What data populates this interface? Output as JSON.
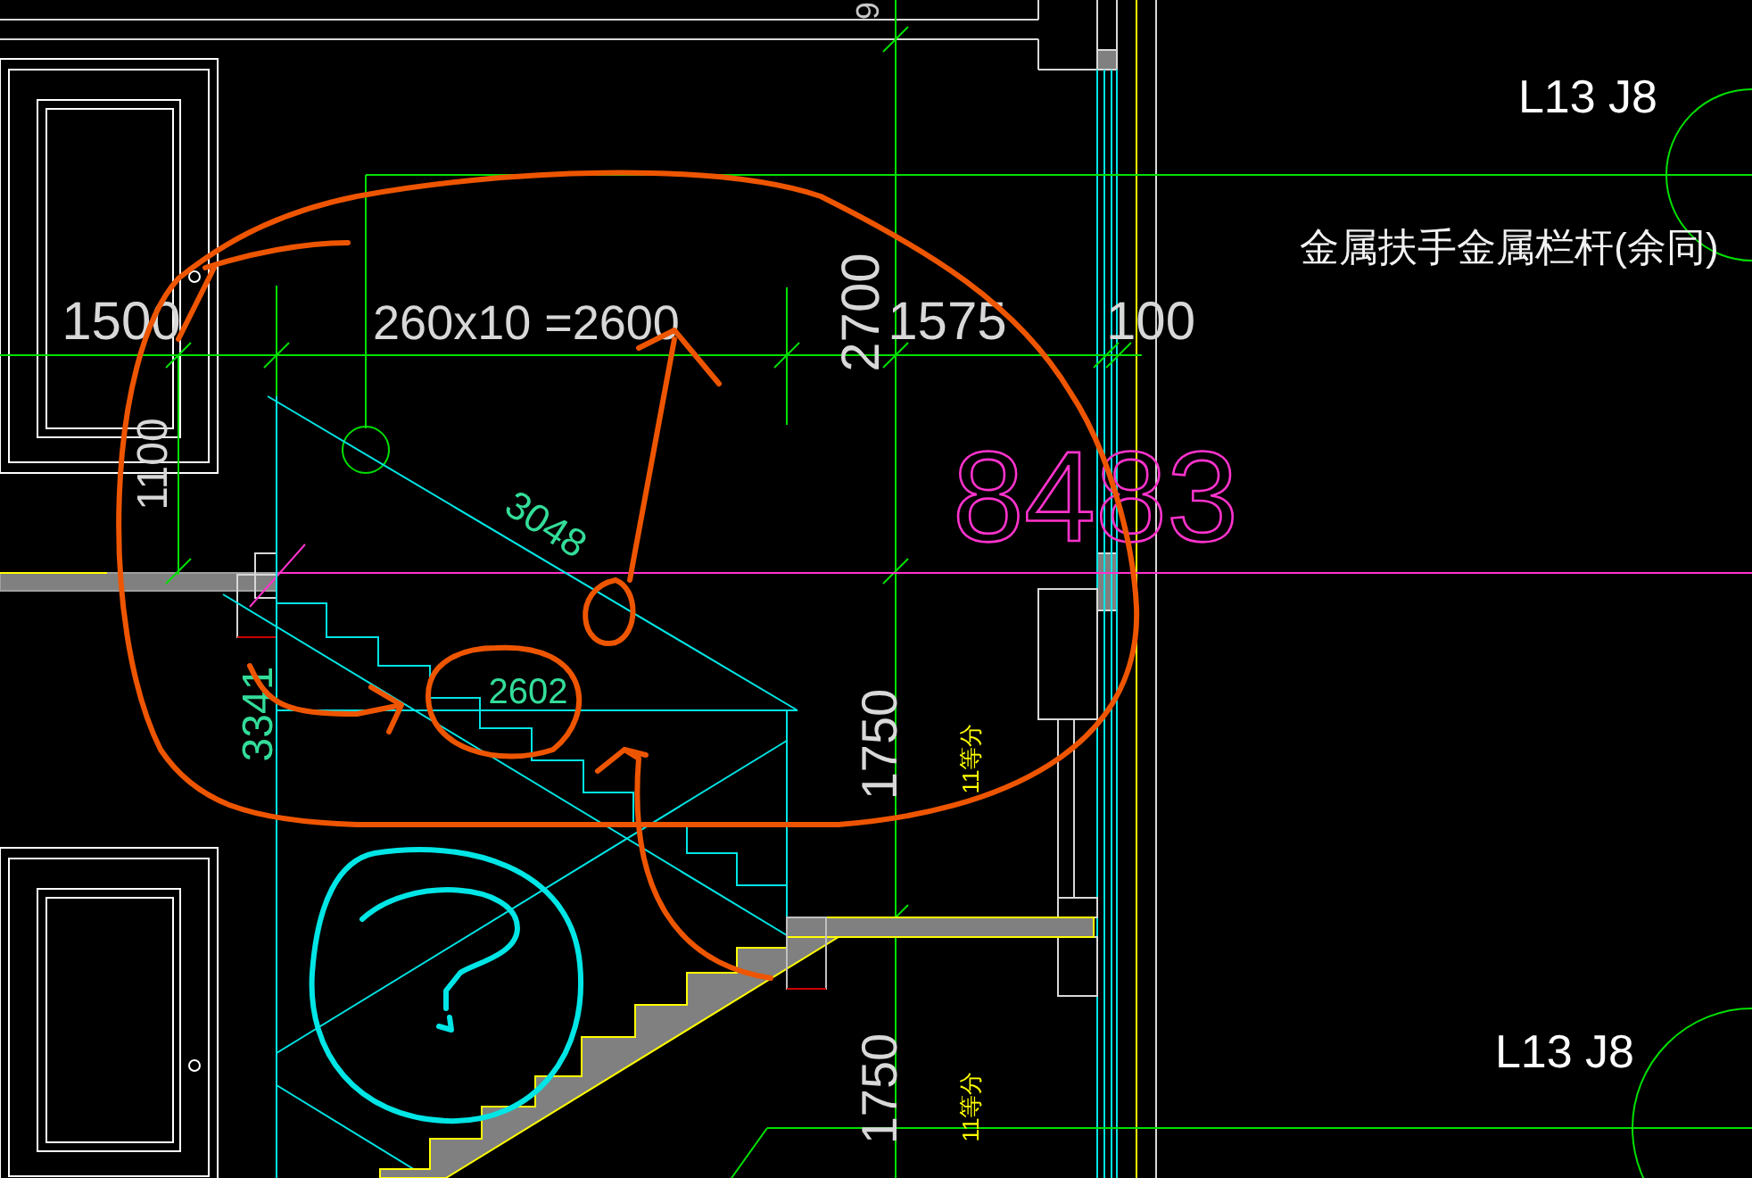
{
  "drawing": {
    "texts": [
      {
        "kind": "grid",
        "text": "6"
      },
      {
        "kind": "reference",
        "text": "L13 J8"
      },
      {
        "kind": "note",
        "text": "金属扶手金属栏杆(余同)"
      },
      {
        "kind": "dimension",
        "text": "1500"
      },
      {
        "kind": "dimension",
        "text": "260x10 =2600"
      },
      {
        "kind": "dimension",
        "text": "2700"
      },
      {
        "kind": "dimension",
        "text": "1575"
      },
      {
        "kind": "dimension",
        "text": "100"
      },
      {
        "kind": "dimension",
        "text": "1100"
      },
      {
        "kind": "slope",
        "text": "3048"
      },
      {
        "kind": "room",
        "text": "8483"
      },
      {
        "kind": "slope",
        "text": "2602"
      },
      {
        "kind": "slope",
        "text": "3341"
      },
      {
        "kind": "dimension",
        "text": "1750"
      },
      {
        "kind": "division",
        "text": "11等分"
      },
      {
        "kind": "reference",
        "text": "L13 J8"
      },
      {
        "kind": "dimension",
        "text": "1750"
      },
      {
        "kind": "division",
        "text": "11等分"
      }
    ]
  }
}
